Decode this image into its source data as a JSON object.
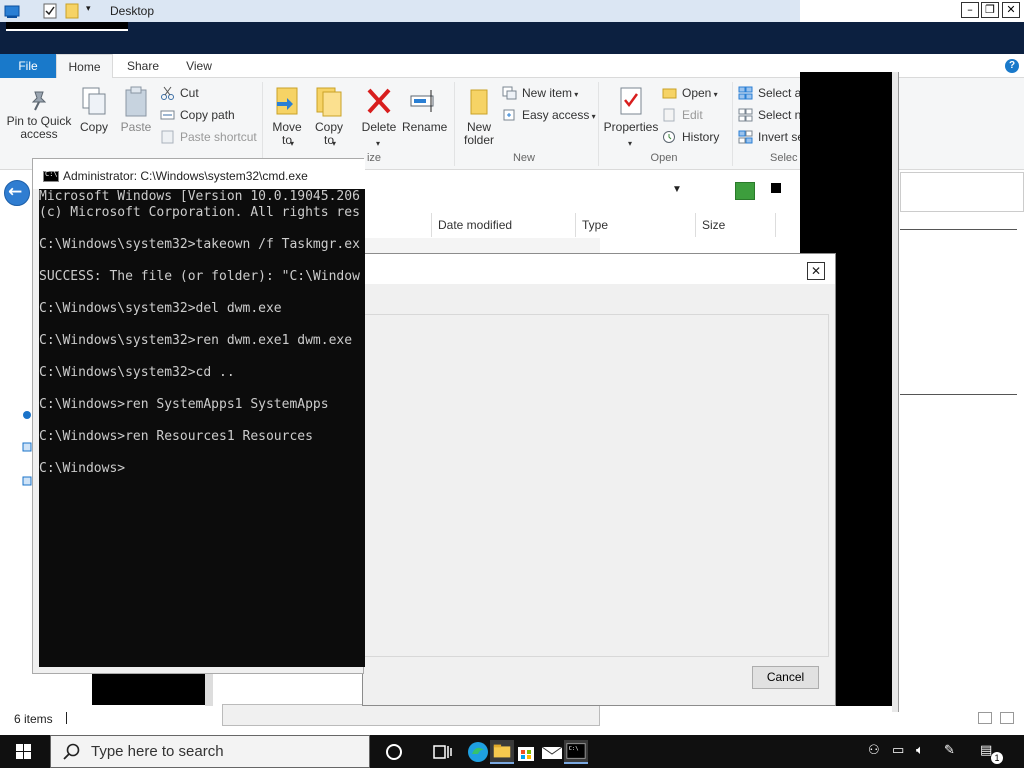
{
  "explorer": {
    "window_title": "Desktop",
    "tabs": {
      "file": "File",
      "home": "Home",
      "share": "Share",
      "view": "View"
    },
    "ribbon": {
      "clipboard": {
        "pin": "Pin to Quick access",
        "copy": "Copy",
        "paste": "Paste",
        "cut": "Cut",
        "copy_path": "Copy path",
        "paste_shortcut": "Paste shortcut"
      },
      "organize": {
        "move_to": "Move to",
        "copy_to": "Copy to",
        "delete": "Delete",
        "rename": "Rename",
        "label": "ize"
      },
      "new": {
        "new_folder": "New folder",
        "new_item": "New item",
        "easy_access": "Easy access",
        "label": "New"
      },
      "open": {
        "properties": "Properties",
        "open": "Open",
        "edit": "Edit",
        "history": "History",
        "label": "Open"
      },
      "select": {
        "select_all": "Select al",
        "select_none": "Select no",
        "invert": "Invert se",
        "label": "Selec"
      }
    },
    "columns": [
      "Date modified",
      "Type",
      "Size"
    ],
    "status": {
      "items": "6 items"
    }
  },
  "dialog": {
    "cancel": "Cancel"
  },
  "cmd": {
    "title": "Administrator: C:\\Windows\\system32\\cmd.exe",
    "lines": [
      "Microsoft Windows [Version 10.0.19045.206",
      "(c) Microsoft Corporation. All rights res",
      "",
      "C:\\Windows\\system32>takeown /f Taskmgr.ex",
      "",
      "SUCCESS: The file (or folder): \"C:\\Window",
      "",
      "C:\\Windows\\system32>del dwm.exe",
      "",
      "C:\\Windows\\system32>ren dwm.exe1 dwm.exe",
      "",
      "C:\\Windows\\system32>cd ..",
      "",
      "C:\\Windows>ren SystemApps1 SystemApps",
      "",
      "C:\\Windows>ren Resources1 Resources",
      "",
      "C:\\Windows>"
    ]
  },
  "taskbar": {
    "search_placeholder": "Type here to search",
    "notification_count": "1"
  },
  "colors": {
    "accent": "#1979ca",
    "cmd_bg": "#0c0c0c",
    "cmd_fg": "#cccccc",
    "taskbar": "#101010"
  }
}
